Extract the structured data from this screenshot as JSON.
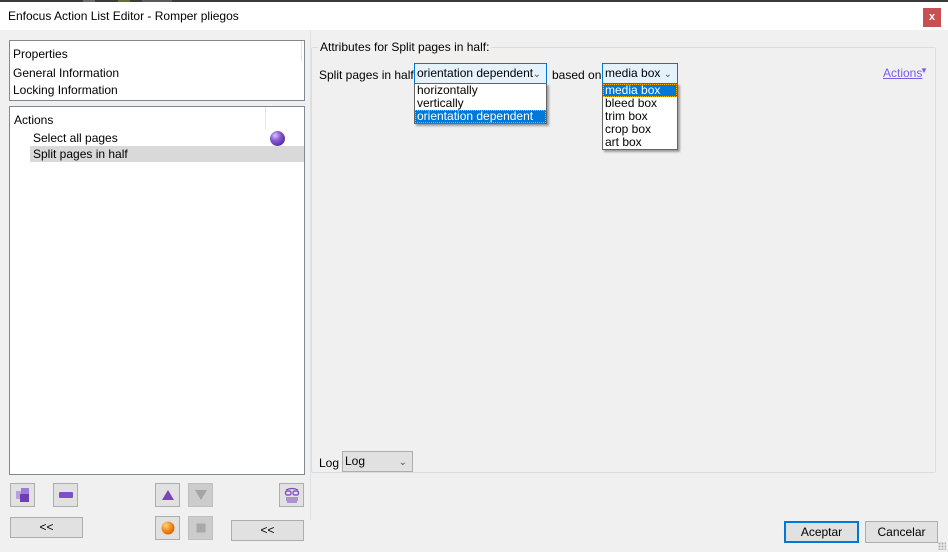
{
  "window": {
    "title": "Enfocus Action List Editor - Romper pliegos",
    "close_label": "x"
  },
  "properties": {
    "header": "Properties",
    "items": [
      "General Information",
      "Locking Information"
    ]
  },
  "actions_list": {
    "header": "Actions",
    "items": [
      {
        "label": "Select all pages",
        "status_icon": "purple-ball-icon",
        "selected": false
      },
      {
        "label": "Split pages in half",
        "status_icon": null,
        "selected": true
      }
    ]
  },
  "toolbar": {
    "add_icon": "add-action-icon",
    "remove_icon": "remove-action-icon",
    "up_icon": "move-up-icon",
    "down_icon": "move-down-icon",
    "preview_icon": "glasses-icon",
    "record_icon": "record-icon",
    "stop_icon": "stop-icon",
    "collapse_left_label": "<<",
    "collapse_right_label": "<<"
  },
  "attributes": {
    "group_title": "Attributes for Split pages in half:",
    "split_label": "Split pages in half:",
    "split_value": "orientation dependent",
    "split_options": [
      "horizontally",
      "vertically",
      "orientation dependent"
    ],
    "split_selected_index": 2,
    "based_on_label": "based on",
    "box_value": "media box",
    "box_options": [
      "media box",
      "bleed box",
      "trim box",
      "crop box",
      "art box"
    ],
    "box_selected_index": 0,
    "actions_menu_label": "Actions",
    "log_label": "Log",
    "log_value": "Log"
  },
  "footer": {
    "ok_label": "Aceptar",
    "cancel_label": "Cancelar"
  },
  "colors": {
    "accent": "#0078d7",
    "close_button": "#c75050",
    "link": "#7b5de5",
    "selection_row": "#d9d9d9"
  }
}
